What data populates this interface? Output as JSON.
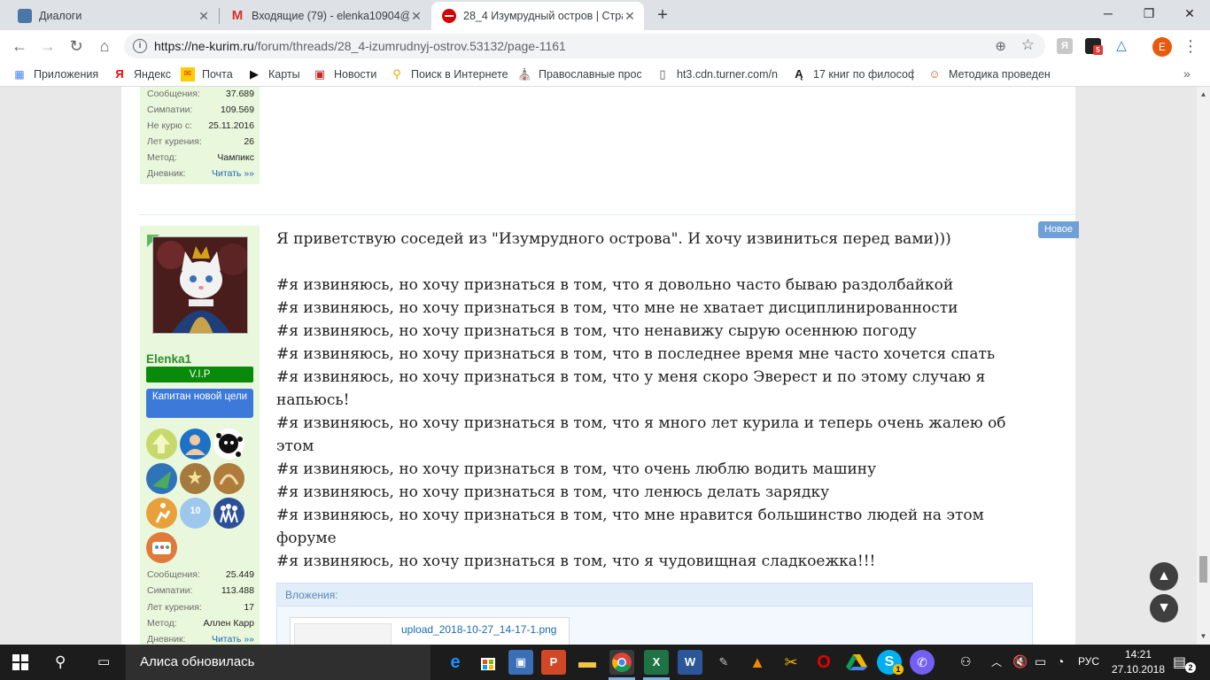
{
  "tabs": [
    {
      "title": "Диалоги",
      "favicon": "vk-dialogs-icon",
      "color": "#4a76a8"
    },
    {
      "title": "Входящие (79) - elenka10904@g",
      "favicon": "gmail-icon",
      "color": "#d93025"
    },
    {
      "title": "28_4 Изумрудный остров | Стра",
      "favicon": "ne-kurim-icon",
      "color": "#d50000"
    }
  ],
  "toolbar": {
    "url_host": "https://ne-kurim.ru",
    "url_path": "/forum/threads/28_4-izumrudnyj-ostrov.53132/page-1161",
    "profile_letter": "E",
    "ext_badge": "5"
  },
  "bookmarks": [
    {
      "label": "Приложения",
      "icon": "apps-grid-icon"
    },
    {
      "label": "Яндекс",
      "icon": "yandex-icon"
    },
    {
      "label": "Почта",
      "icon": "mail-icon"
    },
    {
      "label": "Карты",
      "icon": "maps-icon"
    },
    {
      "label": "Новости",
      "icon": "news-icon"
    },
    {
      "label": "Поиск в Интернете",
      "icon": "search-web-icon"
    },
    {
      "label": "Православные прос",
      "icon": "orthodox-icon"
    },
    {
      "label": "ht3.cdn.turner.com/n",
      "icon": "page-icon"
    },
    {
      "label": "17 книг по философ",
      "icon": "book-icon"
    },
    {
      "label": "Методика проведен",
      "icon": "method-icon"
    }
  ],
  "post1_stats": [
    {
      "label": "Сообщения:",
      "value": "37.689"
    },
    {
      "label": "Симпатии:",
      "value": "109.569"
    },
    {
      "label": "Не курю с:",
      "value": "25.11.2016"
    },
    {
      "label": "Лет курения:",
      "value": "26"
    },
    {
      "label": "Метод:",
      "value": "Чампикс"
    },
    {
      "label": "Дневник:",
      "value": "Читать »»"
    }
  ],
  "post2": {
    "username": "Elenka1",
    "rank": "V.I.P",
    "title_badge": "Капитан новой цели",
    "new_badge": "Новое",
    "stats": [
      {
        "label": "Сообщения:",
        "value": "25.449"
      },
      {
        "label": "Симпатии:",
        "value": "113.488"
      },
      {
        "label": "Лет курения:",
        "value": "17"
      },
      {
        "label": "Метод:",
        "value": "Аллен Карр"
      },
      {
        "label": "Дневник:",
        "value": "Читать »»"
      }
    ],
    "text_first": "Я приветствую соседей из \"Изумрудного острова\". И хочу извиниться перед вами)))",
    "text_lines": [
      "#я извиняюсь, но хочу признаться в том, что я довольно часто бываю раздолбайкой",
      "#я извиняюсь, но хочу признаться в том, что мне не хватает дисциплинированности",
      "#я извиняюсь, но хочу признаться в том, что ненавижу сырую осеннюю погоду",
      "#я извиняюсь, но хочу признаться в том, что в последнее время мне часто хочется спать",
      "#я извиняюсь, но хочу признаться в том, что у меня скоро Эверест и по этому случаю я",
      "напьюсь!",
      "#я извиняюсь, но хочу признаться в том, что я много лет курила и теперь очень жалею об",
      "этом",
      "#я извиняюсь, но хочу признаться в том, что очень люблю водить машину",
      "#я извиняюсь, но хочу признаться в том, что ленюсь делать зарядку",
      "#я извиняюсь, но хочу признаться в том, что мне нравится большинство людей на этом",
      "форуме",
      "#я извиняюсь, но хочу признаться в том, что я чудовищная сладкоежка!!!"
    ],
    "attachments_label": "Вложения:",
    "attachment_name": "upload_2018-10-27_14-17-1.png"
  },
  "taskbar": {
    "search_text": "Алиса обновилась",
    "lang": "РУС",
    "time": "14:21",
    "date": "27.10.2018",
    "notify_count": "2",
    "skype_badge": "1"
  }
}
